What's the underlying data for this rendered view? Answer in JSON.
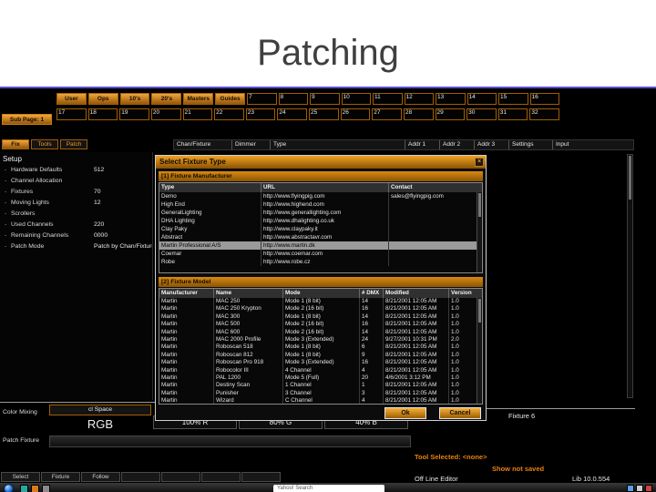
{
  "slide": {
    "title": "Patching"
  },
  "colors": {
    "accent": "#e8920e",
    "selection": "#9a9a9a"
  },
  "window": {
    "grid": {
      "row1_labels": [
        "User",
        "Ops",
        "10's",
        "20's",
        "Masters",
        "Guides"
      ],
      "row1_numbers": [
        "7",
        "8",
        "9",
        "10",
        "11",
        "12",
        "13",
        "14",
        "15",
        "16"
      ],
      "sub_page_label": "Sub Page: 1",
      "row2_numbers": [
        "17",
        "18",
        "19",
        "20",
        "21",
        "22",
        "23",
        "24",
        "25",
        "26",
        "27",
        "28",
        "29",
        "30",
        "31",
        "32"
      ]
    },
    "toolbar": {
      "tabs": [
        "Fix",
        "Tools",
        "Patch"
      ],
      "columns": [
        "Chan/Fixture",
        "Dimmer",
        "Type",
        "Addr 1",
        "Addr 2",
        "Addr 3",
        "Settings",
        "Input"
      ]
    },
    "setup": {
      "title": "Setup",
      "items": [
        {
          "label": "Hardware Defaults",
          "value": "512"
        },
        {
          "label": "Channel Allocation",
          "value": ""
        },
        {
          "label": "Fixtures",
          "value": "70"
        },
        {
          "label": "Moving Lights",
          "value": "12"
        },
        {
          "label": "Scrollers",
          "value": ""
        },
        {
          "label": "Used Channels",
          "value": "220"
        },
        {
          "label": "Remaining Channels",
          "value": "0000"
        },
        {
          "label": "Patch Mode",
          "value": "Patch by Chan/Fixture"
        }
      ]
    },
    "dialog": {
      "title": "Select Fixture Type",
      "manufacturers": {
        "label": "[1] Fixture Manufacturer",
        "columns": [
          "Type",
          "URL",
          "Contact"
        ],
        "rows": [
          {
            "type": "Demo",
            "url": "http://www.flyingpig.com",
            "contact": "sales@flyingpig.com"
          },
          {
            "type": "High End",
            "url": "http://www.highend.com",
            "contact": ""
          },
          {
            "type": "GeneralLighting",
            "url": "http://www.generallighting.com",
            "contact": ""
          },
          {
            "type": "DHA Lighting",
            "url": "http://www.dhalighting.co.uk",
            "contact": ""
          },
          {
            "type": "Clay Paky",
            "url": "http://www.claypaky.it",
            "contact": ""
          },
          {
            "type": "Abstract",
            "url": "http://www.abstractavr.com",
            "contact": ""
          },
          {
            "type": "Martin Professional A/S",
            "url": "http://www.martin.dk",
            "contact": "",
            "selected": true
          },
          {
            "type": "Coemar",
            "url": "http://www.coemar.com",
            "contact": ""
          },
          {
            "type": "Robe",
            "url": "http://www.robe.cz",
            "contact": ""
          }
        ]
      },
      "models": {
        "label": "[2] Fixture Model",
        "columns": [
          "Manufacturer",
          "Name",
          "Mode",
          "# DMX",
          "Modified",
          "Version"
        ],
        "rows": [
          {
            "manufacturer": "Martin",
            "name": "MAC 250",
            "mode": "Mode 1 (8 bit)",
            "dmx": "14",
            "modified": "8/21/2001 12:05 AM",
            "version": "1.0"
          },
          {
            "manufacturer": "Martin",
            "name": "MAC 250 Krypton",
            "mode": "Mode 2 (16 bit)",
            "dmx": "16",
            "modified": "8/21/2001 12:05 AM",
            "version": "1.0"
          },
          {
            "manufacturer": "Martin",
            "name": "MAC 300",
            "mode": "Mode 1 (8 bit)",
            "dmx": "14",
            "modified": "8/21/2001 12:05 AM",
            "version": "1.0"
          },
          {
            "manufacturer": "Martin",
            "name": "MAC 500",
            "mode": "Mode 2 (16 bit)",
            "dmx": "16",
            "modified": "8/21/2001 12:05 AM",
            "version": "1.0"
          },
          {
            "manufacturer": "Martin",
            "name": "MAC 600",
            "mode": "Mode 2 (16 bit)",
            "dmx": "14",
            "modified": "8/21/2001 12:05 AM",
            "version": "1.0"
          },
          {
            "manufacturer": "Martin",
            "name": "MAC 2000 Profile",
            "mode": "Mode 3 (Extended)",
            "dmx": "24",
            "modified": "9/27/2001 10:31 PM",
            "version": "2.0"
          },
          {
            "manufacturer": "Martin",
            "name": "Roboscan 518",
            "mode": "Mode 1 (8 bit)",
            "dmx": "6",
            "modified": "8/21/2001 12:05 AM",
            "version": "1.0"
          },
          {
            "manufacturer": "Martin",
            "name": "Roboscan 812",
            "mode": "Mode 1 (8 bit)",
            "dmx": "9",
            "modified": "8/21/2001 12:05 AM",
            "version": "1.0"
          },
          {
            "manufacturer": "Martin",
            "name": "Roboscan Pro 918",
            "mode": "Mode 3 (Extended)",
            "dmx": "16",
            "modified": "8/21/2001 12:05 AM",
            "version": "1.0"
          },
          {
            "manufacturer": "Martin",
            "name": "Robocolor III",
            "mode": "4 Channel",
            "dmx": "4",
            "modified": "8/21/2001 12:05 AM",
            "version": "1.0"
          },
          {
            "manufacturer": "Martin",
            "name": "PAL 1200",
            "mode": "Mode 5 (Full)",
            "dmx": "20",
            "modified": "4/6/2001 3:12 PM",
            "version": "1.0"
          },
          {
            "manufacturer": "Martin",
            "name": "Destiny Scan",
            "mode": "1 Channel",
            "dmx": "1",
            "modified": "8/21/2001 12:05 AM",
            "version": "1.0"
          },
          {
            "manufacturer": "Martin",
            "name": "Punisher",
            "mode": "3 Channel",
            "dmx": "3",
            "modified": "8/21/2001 12:05 AM",
            "version": "1.0"
          },
          {
            "manufacturer": "Martin",
            "name": "Wizard",
            "mode": "C Channel",
            "dmx": "4",
            "modified": "8/21/2001 12:05 AM",
            "version": "1.0"
          }
        ]
      },
      "ok_label": "Ok",
      "cancel_label": "Cancel",
      "close_glyph": "×"
    },
    "bottom": {
      "color_mixing_label": "Color Mixing",
      "cl_space_label": "cl Space",
      "rgb_label": "RGB",
      "mix_values": [
        "100% R",
        "80% G",
        "40% B"
      ],
      "fixture_label": "Fixture 6",
      "patch_fixture_label": "Patch Fixture",
      "tool_selected": "Tool Selected: <none>",
      "show_not_saved": "Show not saved",
      "offline_editor": "Off Line Editor",
      "lib_version": "Lib 10.0.554",
      "tabs": [
        "Select",
        "Fixture",
        "Follow",
        "",
        "",
        "",
        ""
      ]
    }
  },
  "taskbar": {
    "search_text": "Yahoo! Search"
  }
}
